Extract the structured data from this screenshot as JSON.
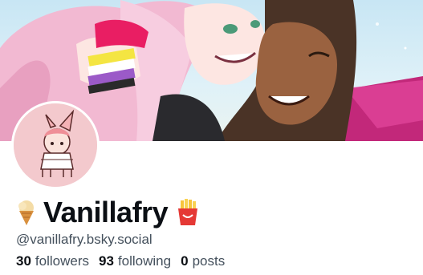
{
  "profile": {
    "display_name": "Vanillafry",
    "name_prefix_icon": "ice-cream-icon",
    "name_suffix_icon": "fries-icon",
    "handle": "@vanillafry.bsky.social",
    "stats": {
      "followers_count": "30",
      "followers_label": "followers",
      "following_count": "93",
      "following_label": "following",
      "posts_count": "0",
      "posts_label": "posts"
    }
  },
  "colors": {
    "text": "#0b0f14",
    "secondary_text": "#44505c",
    "avatar_bg": "#f3c9cd",
    "banner_sky": "#c8e6f4"
  }
}
